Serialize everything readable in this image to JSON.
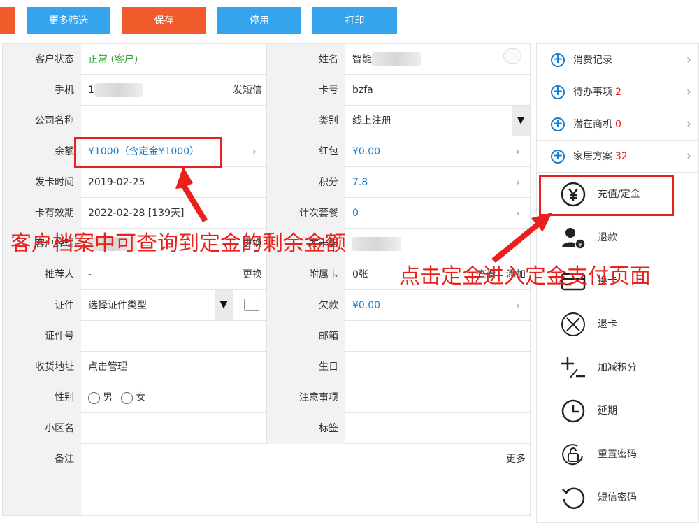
{
  "toolbar": {
    "more_filter": "更多筛选",
    "save": "保存",
    "disable": "停用",
    "print": "打印"
  },
  "form": {
    "customer_status": {
      "label": "客户状态",
      "value": "正常 (客户)"
    },
    "name": {
      "label": "姓名",
      "value": "智能"
    },
    "phone": {
      "label": "手机",
      "value": "1",
      "action": "发短信"
    },
    "card_no": {
      "label": "卡号",
      "value": "bzfa"
    },
    "company": {
      "label": "公司名称",
      "value": ""
    },
    "category": {
      "label": "类别",
      "value": "线上注册"
    },
    "balance": {
      "label": "余额",
      "value": "¥1000（含定金¥1000）"
    },
    "red_packet": {
      "label": "红包",
      "value": "¥0.00"
    },
    "issue_date": {
      "label": "发卡时间",
      "value": "2019-02-25"
    },
    "points": {
      "label": "积分",
      "value": "7.8"
    },
    "expiry": {
      "label": "卡有效期",
      "value": "2022-02-28 [139天]"
    },
    "package": {
      "label": "计次套餐",
      "value": "0"
    },
    "manager": {
      "label": "客户经理",
      "action": "更换"
    },
    "store": {
      "label": "发卡店"
    },
    "referrer": {
      "label": "推荐人",
      "value": "-",
      "action": "更换"
    },
    "sub_card": {
      "label": "附属卡",
      "value": "0张",
      "action1": "查看",
      "action2": "添加"
    },
    "id_type": {
      "label": "证件",
      "value": "选择证件类型"
    },
    "debt": {
      "label": "欠款",
      "value": "¥0.00"
    },
    "id_no": {
      "label": "证件号",
      "value": ""
    },
    "email": {
      "label": "邮箱",
      "value": ""
    },
    "address": {
      "label": "收货地址",
      "value": "点击管理"
    },
    "birthday": {
      "label": "生日",
      "value": ""
    },
    "gender": {
      "label": "性别",
      "male": "男",
      "female": "女"
    },
    "notes": {
      "label": "注意事项",
      "value": ""
    },
    "community": {
      "label": "小区名",
      "value": ""
    },
    "tags": {
      "label": "标签",
      "value": ""
    },
    "remark": {
      "label": "备注",
      "more": "更多"
    }
  },
  "panel": {
    "links": [
      {
        "label": "消费记录",
        "count": ""
      },
      {
        "label": "待办事项",
        "count": "2"
      },
      {
        "label": "潜在商机",
        "count": "0"
      },
      {
        "label": "家居方案",
        "count": "32"
      }
    ],
    "actions": [
      {
        "label": "充值/定金",
        "icon": "yen-circle-icon"
      },
      {
        "label": "退款",
        "icon": "user-refund-icon"
      },
      {
        "label": "换卡",
        "icon": "card-icon"
      },
      {
        "label": "退卡",
        "icon": "x-circle-icon"
      },
      {
        "label": "加减积分",
        "icon": "plus-minus-icon"
      },
      {
        "label": "延期",
        "icon": "clock-icon"
      },
      {
        "label": "重置密码",
        "icon": "unlock-icon"
      },
      {
        "label": "短信密码",
        "icon": "refresh-icon"
      }
    ]
  },
  "annotations": {
    "left": "客户档案中可查询到定金的剩余金额",
    "right": "点击定金进入定金支付页面"
  },
  "colors": {
    "accent_red": "#e8211d",
    "blue_button": "#35a4ec",
    "orange_button": "#f15a2a",
    "link_blue": "#1b7fcc"
  }
}
